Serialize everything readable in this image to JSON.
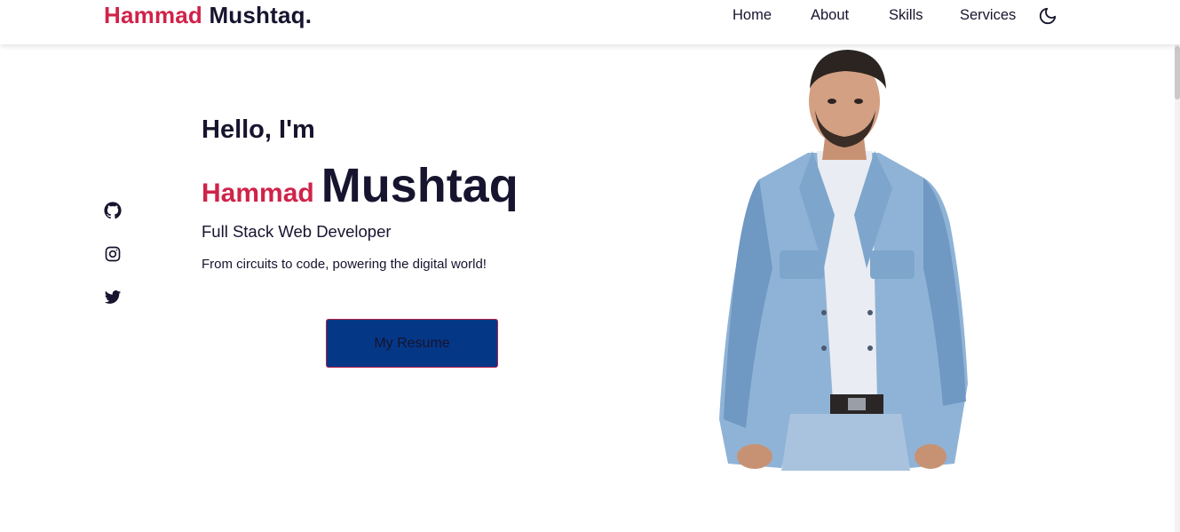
{
  "header": {
    "brand_first": "Hammad",
    "brand_last": "Mushtaq.",
    "nav": [
      {
        "label": "Home"
      },
      {
        "label": "About"
      },
      {
        "label": "Skills"
      },
      {
        "label": "Services"
      }
    ],
    "theme_icon": "moon-icon"
  },
  "social": [
    {
      "icon": "github-icon"
    },
    {
      "icon": "instagram-icon"
    },
    {
      "icon": "twitter-icon"
    }
  ],
  "hero": {
    "greeting": "Hello, I'm",
    "first_name": "Hammad",
    "last_name": "Mushtaq",
    "role": "Full Stack Web Developer",
    "tagline": "From circuits to code, powering the digital world!",
    "resume_button": "My Resume"
  },
  "colors": {
    "accent": "#d0234a",
    "dark": "#16142e",
    "button_bg": "#053787"
  }
}
